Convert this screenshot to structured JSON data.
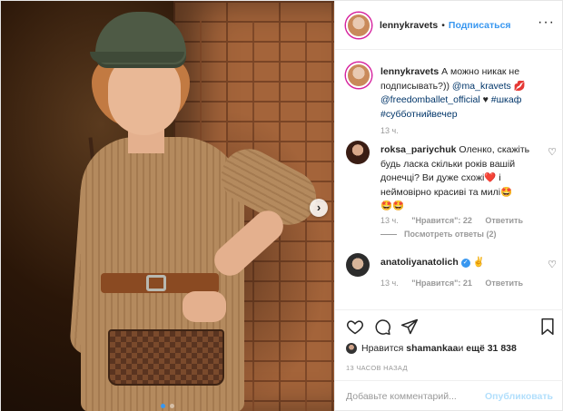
{
  "header": {
    "username": "lennykravets",
    "separator": "•",
    "follow_label": "Подписаться",
    "more_label": "···"
  },
  "photo": {
    "carousel_dots": 2,
    "active_dot": 1,
    "next_arrow": "›"
  },
  "caption": {
    "username": "lennykravets",
    "text_1": "А можно никак не подписывать?)) ",
    "mention_1": "@ma_kravets",
    "emoji_1": "💋",
    "mention_2": "@freedomballet_official",
    "heart": "♥",
    "hashtag_1": "#шкаф",
    "hashtag_2": "#субботнийвечер",
    "time": "13 ч."
  },
  "comments": [
    {
      "username": "roksa_pariychuk",
      "text": "Оленко, скажіть будь ласка скільки років вашій донечці? Ви дуже схожі",
      "emoji_1": "❤️",
      "text_2": " і неймовірно красиві та милі",
      "emoji_2": "🤩",
      "emoji_3": "🤩🤩",
      "time": "13 ч.",
      "likes": "\"Нравится\": 22",
      "reply": "Ответить",
      "view_replies": "Посмотреть ответы (2)"
    },
    {
      "username": "anatoliyanatolich",
      "verified": "✓",
      "emoji": "✌️",
      "time": "13 ч.",
      "likes": "\"Нравится\": 21",
      "reply": "Ответить"
    }
  ],
  "actions": {
    "like_icon": "heart-icon",
    "comment_icon": "comment-icon",
    "share_icon": "share-icon",
    "save_icon": "bookmark-icon"
  },
  "likes": {
    "prefix": "Нравится ",
    "user": "shamankaa",
    "middle": " и ",
    "count": "ещё 31 838"
  },
  "time_ago": "13 ЧАСОВ НАЗАД",
  "add_comment": {
    "placeholder": "Добавьте комментарий...",
    "publish_label": "Опубликовать"
  },
  "colors": {
    "accent": "#3897f0",
    "publish_disabled": "#b2dffc",
    "text": "#262626",
    "muted": "#999999"
  }
}
